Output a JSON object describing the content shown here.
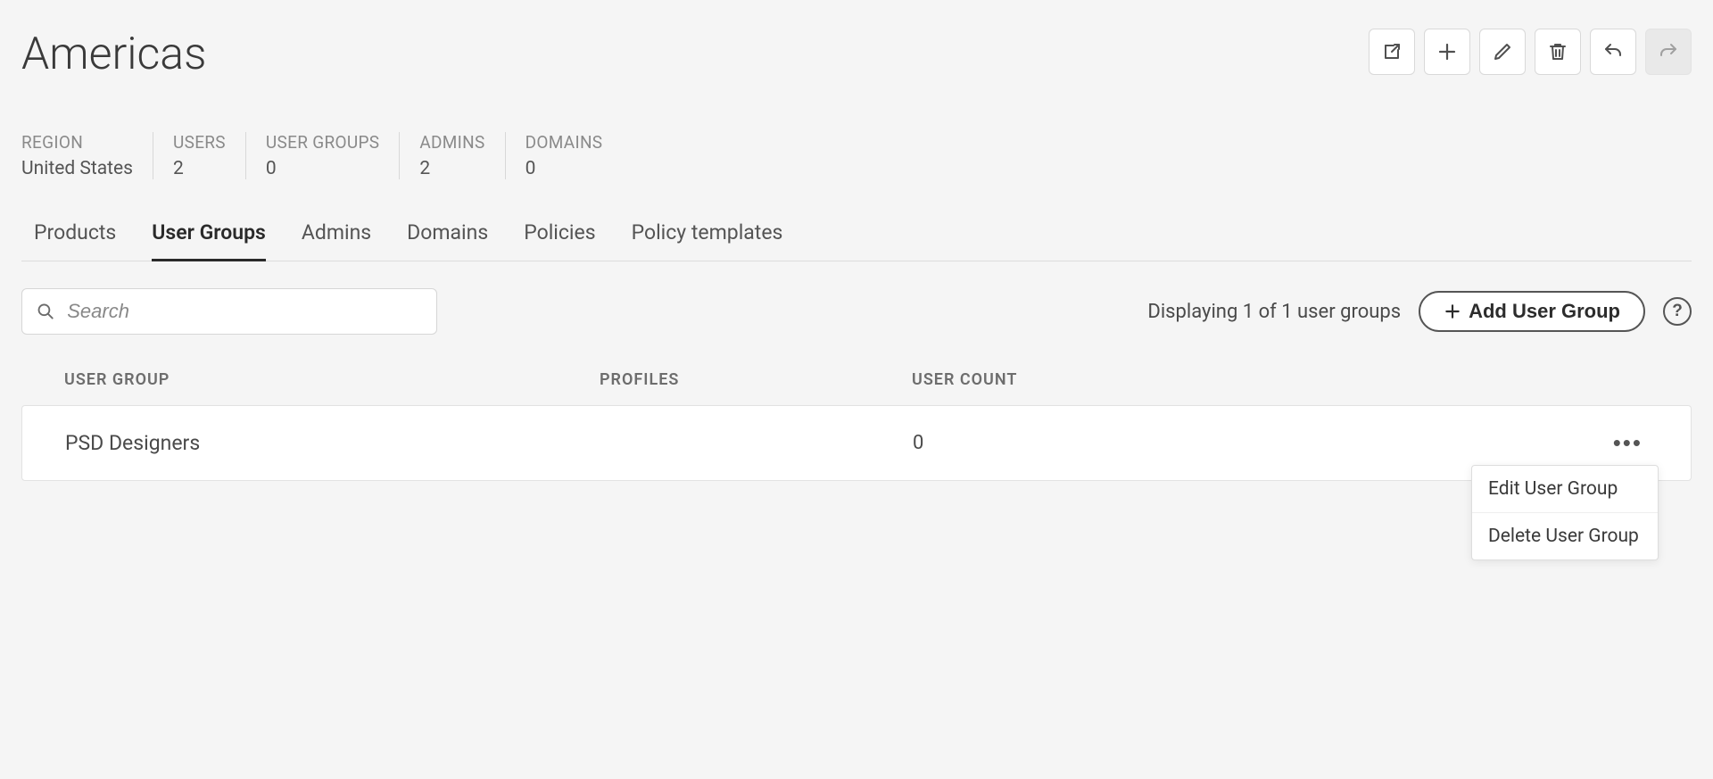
{
  "header": {
    "title": "Americas"
  },
  "stats": [
    {
      "label": "REGION",
      "value": "United States"
    },
    {
      "label": "USERS",
      "value": "2"
    },
    {
      "label": "USER GROUPS",
      "value": "0"
    },
    {
      "label": "ADMINS",
      "value": "2"
    },
    {
      "label": "DOMAINS",
      "value": "0"
    }
  ],
  "tabs": [
    {
      "label": "Products",
      "active": false
    },
    {
      "label": "User Groups",
      "active": true
    },
    {
      "label": "Admins",
      "active": false
    },
    {
      "label": "Domains",
      "active": false
    },
    {
      "label": "Policies",
      "active": false
    },
    {
      "label": "Policy templates",
      "active": false
    }
  ],
  "search": {
    "placeholder": "Search",
    "value": ""
  },
  "display_text": "Displaying 1 of 1 user groups",
  "add_button": "Add User Group",
  "table": {
    "headers": {
      "user_group": "USER GROUP",
      "profiles": "PROFILES",
      "user_count": "USER COUNT"
    },
    "rows": [
      {
        "name": "PSD Designers",
        "profiles": "",
        "user_count": "0"
      }
    ]
  },
  "row_menu": {
    "edit": "Edit User Group",
    "delete": "Delete User Group"
  }
}
